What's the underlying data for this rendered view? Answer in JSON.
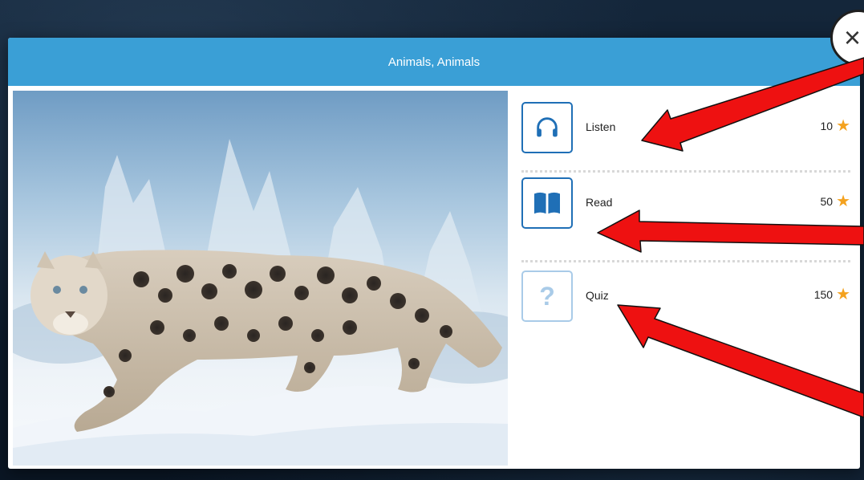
{
  "modal": {
    "title": "Animals, Animals",
    "close_label": "×"
  },
  "activities": [
    {
      "label": "Listen",
      "points": "10",
      "icon": "headphones-icon",
      "enabled": true
    },
    {
      "label": "Read",
      "points": "50",
      "icon": "book-icon",
      "enabled": true
    },
    {
      "label": "Quiz",
      "points": "150",
      "icon": "question-icon",
      "enabled": false
    }
  ],
  "hero_image": {
    "subject": "snow-leopard"
  },
  "colors": {
    "header": "#3a9fd6",
    "icon_border": "#1f6fb6",
    "icon_border_disabled": "#a9cbe8",
    "star": "#f4a21f",
    "arrow": "#ee1111"
  }
}
